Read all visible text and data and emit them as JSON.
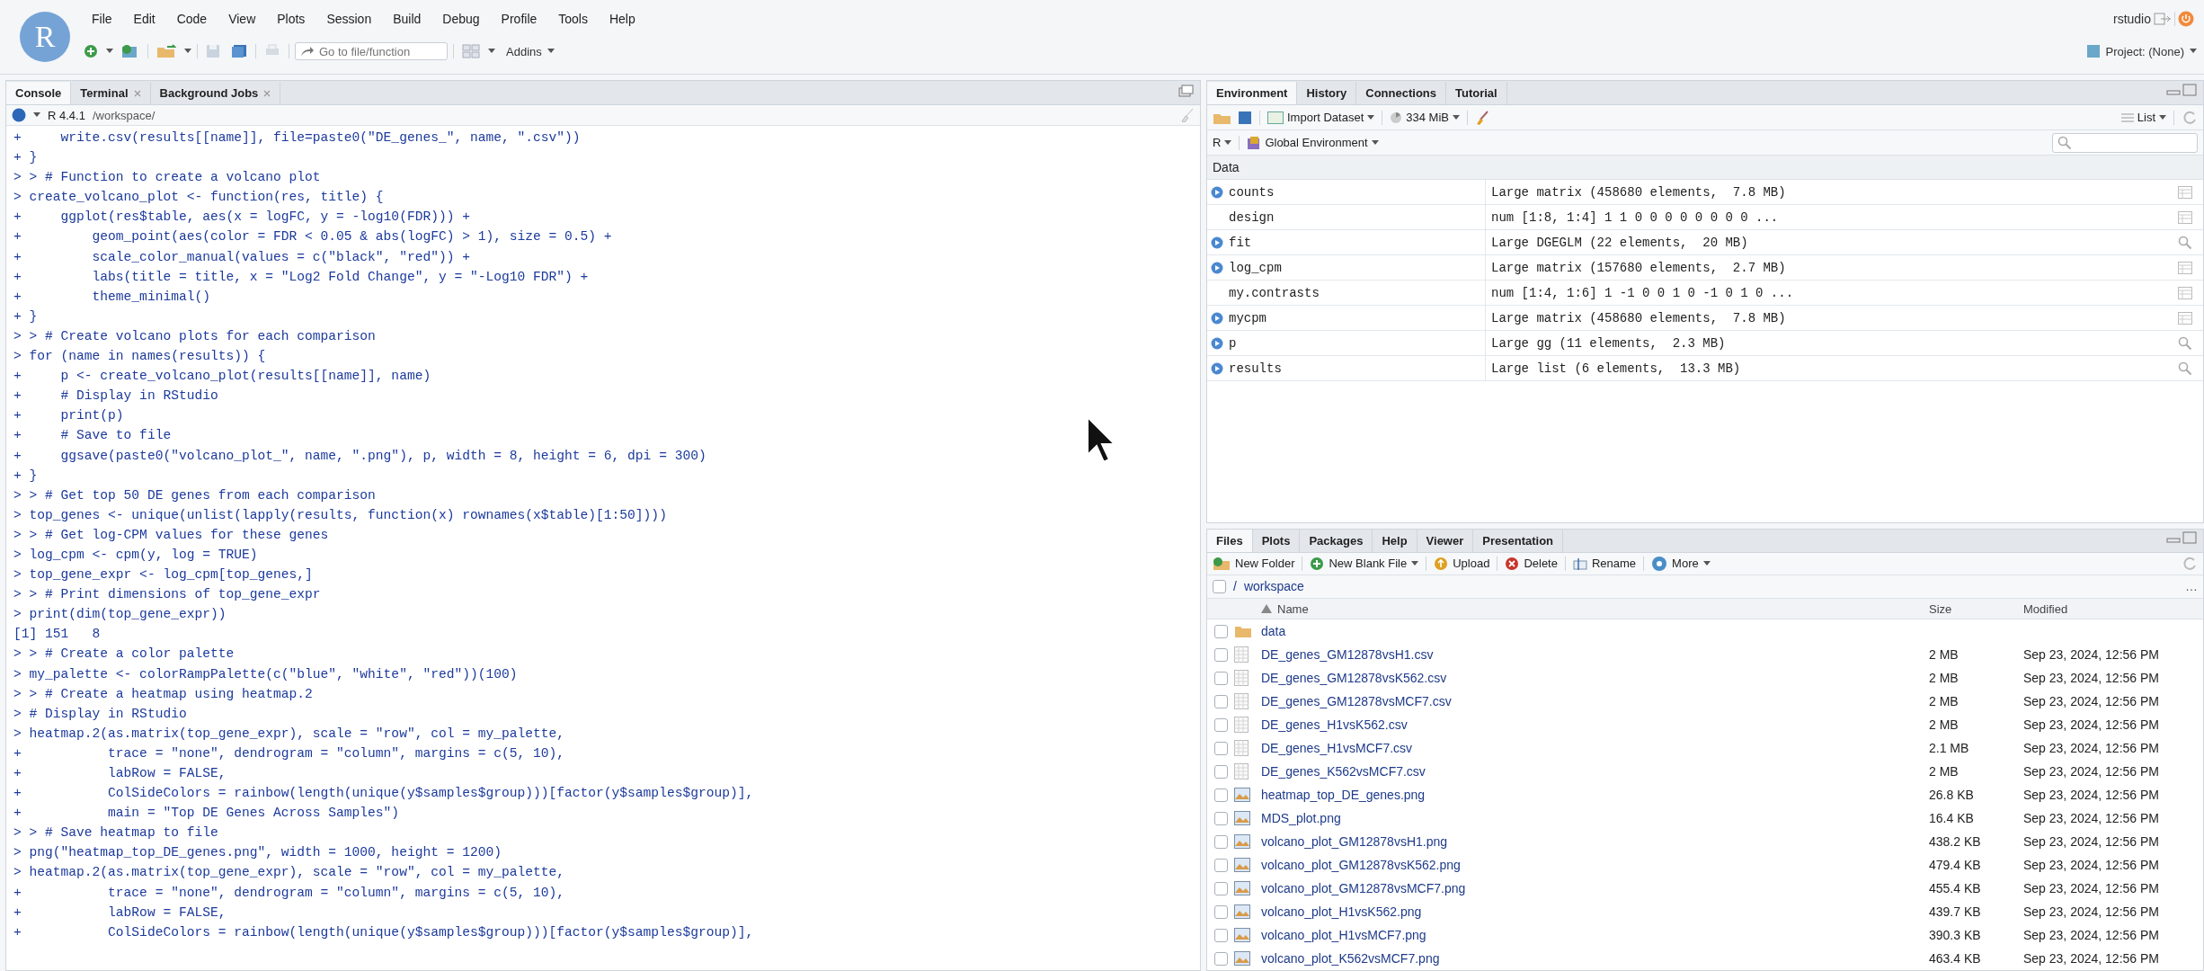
{
  "logo": "R",
  "menu": [
    "File",
    "Edit",
    "Code",
    "View",
    "Plots",
    "Session",
    "Build",
    "Debug",
    "Profile",
    "Tools",
    "Help"
  ],
  "user": "rstudio",
  "toolbar": {
    "goto_placeholder": "Go to file/function",
    "addins": "Addins"
  },
  "project": "Project: (None)",
  "console_tabs": [
    {
      "label": "Console",
      "selected": true,
      "closable": false
    },
    {
      "label": "Terminal",
      "selected": false,
      "closable": true
    },
    {
      "label": "Background Jobs",
      "selected": false,
      "closable": true
    }
  ],
  "console_header": {
    "version": "R 4.4.1",
    "path": "/workspace/"
  },
  "console_lines": [
    "+     write.csv(results[[name]], file=paste0(\"DE_genes_\", name, \".csv\"))",
    "+ }",
    "> > # Function to create a volcano plot",
    "> create_volcano_plot <- function(res, title) {",
    "+     ggplot(res$table, aes(x = logFC, y = -log10(FDR))) +",
    "+         geom_point(aes(color = FDR < 0.05 & abs(logFC) > 1), size = 0.5) +",
    "+         scale_color_manual(values = c(\"black\", \"red\")) +",
    "+         labs(title = title, x = \"Log2 Fold Change\", y = \"-Log10 FDR\") +",
    "+         theme_minimal()",
    "+ }",
    "> > # Create volcano plots for each comparison",
    "> for (name in names(results)) {",
    "+     p <- create_volcano_plot(results[[name]], name)",
    "+     # Display in RStudio",
    "+     print(p)",
    "+     # Save to file",
    "+     ggsave(paste0(\"volcano_plot_\", name, \".png\"), p, width = 8, height = 6, dpi = 300)",
    "+ }",
    "> > # Get top 50 DE genes from each comparison",
    "> top_genes <- unique(unlist(lapply(results, function(x) rownames(x$table)[1:50])))",
    "> > # Get log-CPM values for these genes",
    "> log_cpm <- cpm(y, log = TRUE)",
    "> top_gene_expr <- log_cpm[top_genes,]",
    "> > # Print dimensions of top_gene_expr",
    "> print(dim(top_gene_expr))",
    "[1] 151   8",
    "> > # Create a color palette",
    "> my_palette <- colorRampPalette(c(\"blue\", \"white\", \"red\"))(100)",
    "> > # Create a heatmap using heatmap.2",
    "> # Display in RStudio",
    "> heatmap.2(as.matrix(top_gene_expr), scale = \"row\", col = my_palette,",
    "+           trace = \"none\", dendrogram = \"column\", margins = c(5, 10),",
    "+           labRow = FALSE,",
    "+           ColSideColors = rainbow(length(unique(y$samples$group)))[factor(y$samples$group)],",
    "+           main = \"Top DE Genes Across Samples\")",
    "> > # Save heatmap to file",
    "> png(\"heatmap_top_DE_genes.png\", width = 1000, height = 1200)",
    "> heatmap.2(as.matrix(top_gene_expr), scale = \"row\", col = my_palette,",
    "+           trace = \"none\", dendrogram = \"column\", margins = c(5, 10),",
    "+           labRow = FALSE,",
    "+           ColSideColors = rainbow(length(unique(y$samples$group)))[factor(y$samples$group)],"
  ],
  "env_tabs": [
    {
      "label": "Environment",
      "selected": true
    },
    {
      "label": "History",
      "selected": false
    },
    {
      "label": "Connections",
      "selected": false
    },
    {
      "label": "Tutorial",
      "selected": false
    }
  ],
  "env_toolbar": {
    "import": "Import Dataset",
    "memory": "334 MiB",
    "view": "List"
  },
  "env_scope": {
    "language": "R",
    "environment": "Global Environment"
  },
  "env_section": "Data",
  "variables": [
    {
      "name": "counts",
      "value": "Large matrix (458680 elements,  7.8 MB)",
      "expandable": true,
      "kind": "table"
    },
    {
      "name": "design",
      "value": "num [1:8, 1:4] 1 1 0 0 0 0 0 0 0 0 ...",
      "expandable": false,
      "kind": "table"
    },
    {
      "name": "fit",
      "value": "Large DGEGLM (22 elements,  20 MB)",
      "expandable": true,
      "kind": "search"
    },
    {
      "name": "log_cpm",
      "value": "Large matrix (157680 elements,  2.7 MB)",
      "expandable": true,
      "kind": "table"
    },
    {
      "name": "my.contrasts",
      "value": "num [1:4, 1:6] 1 -1 0 0 1 0 -1 0 1 0 ...",
      "expandable": false,
      "kind": "table"
    },
    {
      "name": "mycpm",
      "value": "Large matrix (458680 elements,  7.8 MB)",
      "expandable": true,
      "kind": "table"
    },
    {
      "name": "p",
      "value": "Large gg (11 elements,  2.3 MB)",
      "expandable": true,
      "kind": "search"
    },
    {
      "name": "results",
      "value": "Large list (6 elements,  13.3 MB)",
      "expandable": true,
      "kind": "search"
    }
  ],
  "files_tabs": [
    {
      "label": "Files",
      "selected": true
    },
    {
      "label": "Plots",
      "selected": false
    },
    {
      "label": "Packages",
      "selected": false
    },
    {
      "label": "Help",
      "selected": false
    },
    {
      "label": "Viewer",
      "selected": false
    },
    {
      "label": "Presentation",
      "selected": false
    }
  ],
  "files_toolbar": [
    {
      "kind": "new-folder",
      "label": "New Folder",
      "menu": false
    },
    {
      "kind": "new-file",
      "label": "New Blank File",
      "menu": true
    },
    {
      "kind": "upload",
      "label": "Upload",
      "menu": false
    },
    {
      "kind": "delete",
      "label": "Delete",
      "menu": false
    },
    {
      "kind": "rename",
      "label": "Rename",
      "menu": false
    },
    {
      "kind": "more",
      "label": "More",
      "menu": true
    }
  ],
  "breadcrumb": [
    "/",
    "workspace"
  ],
  "breadcrumb_more": "…",
  "select_all_checked": false,
  "files_columns": [
    "Name",
    "Size",
    "Modified"
  ],
  "files": [
    {
      "kind": "folder",
      "name": "data",
      "checked": false
    },
    {
      "kind": "csv",
      "name": "DE_genes_GM12878vsH1.csv",
      "size": "2 MB",
      "modified": "Sep 23, 2024, 12:56 PM",
      "checked": false
    },
    {
      "kind": "csv",
      "name": "DE_genes_GM12878vsK562.csv",
      "size": "2 MB",
      "modified": "Sep 23, 2024, 12:56 PM",
      "checked": false
    },
    {
      "kind": "csv",
      "name": "DE_genes_GM12878vsMCF7.csv",
      "size": "2 MB",
      "modified": "Sep 23, 2024, 12:56 PM",
      "checked": false
    },
    {
      "kind": "csv",
      "name": "DE_genes_H1vsK562.csv",
      "size": "2 MB",
      "modified": "Sep 23, 2024, 12:56 PM",
      "checked": false
    },
    {
      "kind": "csv",
      "name": "DE_genes_H1vsMCF7.csv",
      "size": "2.1 MB",
      "modified": "Sep 23, 2024, 12:56 PM",
      "checked": false
    },
    {
      "kind": "csv",
      "name": "DE_genes_K562vsMCF7.csv",
      "size": "2 MB",
      "modified": "Sep 23, 2024, 12:56 PM",
      "checked": false
    },
    {
      "kind": "image",
      "name": "heatmap_top_DE_genes.png",
      "size": "26.8 KB",
      "modified": "Sep 23, 2024, 12:56 PM",
      "checked": false
    },
    {
      "kind": "image",
      "name": "MDS_plot.png",
      "size": "16.4 KB",
      "modified": "Sep 23, 2024, 12:56 PM",
      "checked": false
    },
    {
      "kind": "image",
      "name": "volcano_plot_GM12878vsH1.png",
      "size": "438.2 KB",
      "modified": "Sep 23, 2024, 12:56 PM",
      "checked": false
    },
    {
      "kind": "image",
      "name": "volcano_plot_GM12878vsK562.png",
      "size": "479.4 KB",
      "modified": "Sep 23, 2024, 12:56 PM",
      "checked": false
    },
    {
      "kind": "image",
      "name": "volcano_plot_GM12878vsMCF7.png",
      "size": "455.4 KB",
      "modified": "Sep 23, 2024, 12:56 PM",
      "checked": false
    },
    {
      "kind": "image",
      "name": "volcano_plot_H1vsK562.png",
      "size": "439.7 KB",
      "modified": "Sep 23, 2024, 12:56 PM",
      "checked": false
    },
    {
      "kind": "image",
      "name": "volcano_plot_H1vsMCF7.png",
      "size": "390.3 KB",
      "modified": "Sep 23, 2024, 12:56 PM",
      "checked": false
    },
    {
      "kind": "image",
      "name": "volcano_plot_K562vsMCF7.png",
      "size": "463.4 KB",
      "modified": "Sep 23, 2024, 12:56 PM",
      "checked": false
    }
  ]
}
